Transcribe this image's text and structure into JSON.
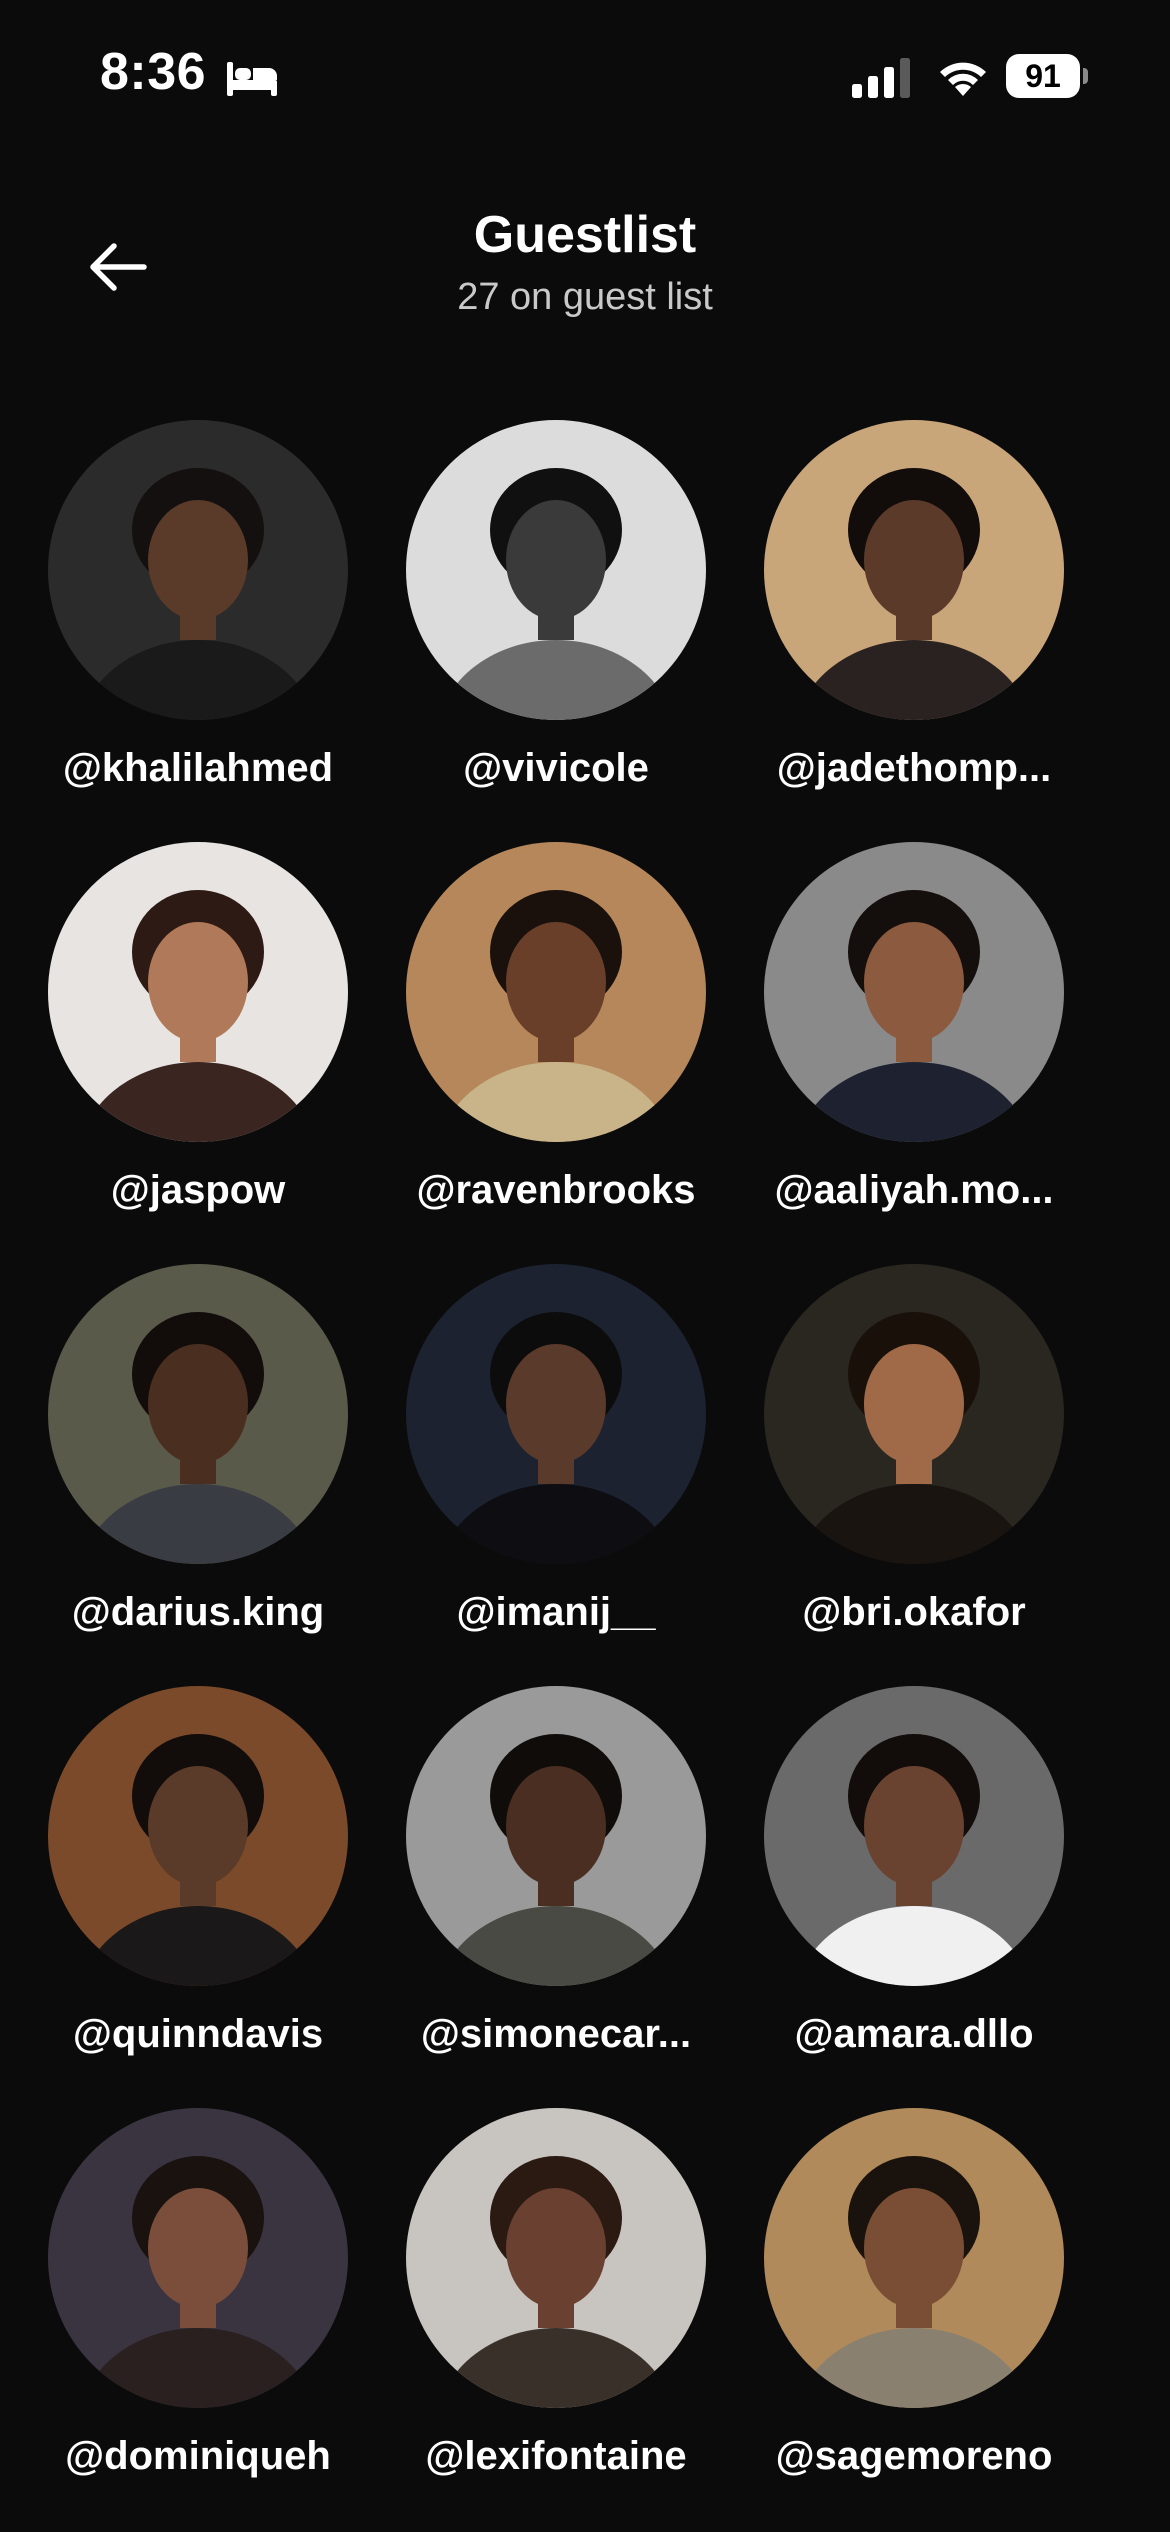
{
  "status_bar": {
    "time": "8:36",
    "battery": "91",
    "icons": [
      "bed-icon",
      "cellular-signal-icon",
      "wifi-icon",
      "battery-icon"
    ]
  },
  "header": {
    "back_icon": "arrow-left-icon",
    "title": "Guestlist",
    "subtitle": "27 on guest list"
  },
  "guests": [
    {
      "handle": "@khalilahmed",
      "bg": "#2b2b2b",
      "skin": "#5a3a28",
      "hair": "#141010",
      "shirt": "#1a1a1a"
    },
    {
      "handle": "@vivicole",
      "bg": "#dcdcdc",
      "skin": "#3a3a3a",
      "hair": "#101010",
      "shirt": "#6b6b6b"
    },
    {
      "handle": "@jadethomp...",
      "bg": "#c9a57a",
      "skin": "#5b3a2a",
      "hair": "#120c0a",
      "shirt": "#2a2220"
    },
    {
      "handle": "@jaspow",
      "bg": "#e8e4e2",
      "skin": "#b07a5a",
      "hair": "#2e1a14",
      "shirt": "#3a2520"
    },
    {
      "handle": "@ravenbrooks",
      "bg": "#b5875a",
      "skin": "#6a3f2a",
      "hair": "#1a100c",
      "shirt": "#c9b48a"
    },
    {
      "handle": "@aaliyah.mo...",
      "bg": "#8a8a8a",
      "skin": "#8c5a3e",
      "hair": "#140e0c",
      "shirt": "#1e2230"
    },
    {
      "handle": "@darius.king",
      "bg": "#5a5a4a",
      "skin": "#4a2e20",
      "hair": "#120c0a",
      "shirt": "#3a3c44"
    },
    {
      "handle": "@imanij__",
      "bg": "#1c2230",
      "skin": "#5a3a2a",
      "hair": "#0c0c0c",
      "shirt": "#0e0e12"
    },
    {
      "handle": "@bri.okafor",
      "bg": "#2a2620",
      "skin": "#a06a48",
      "hair": "#1a100a",
      "shirt": "#1a1410"
    },
    {
      "handle": "@quinndavis",
      "bg": "#7a4a2a",
      "skin": "#5a3a28",
      "hair": "#120c0a",
      "shirt": "#1a1818"
    },
    {
      "handle": "@simonecar...",
      "bg": "#9a9a9a",
      "skin": "#4a2e22",
      "hair": "#100c0a",
      "shirt": "#4a4a44"
    },
    {
      "handle": "@amara.dllo",
      "bg": "#6a6a6a",
      "skin": "#6a4230",
      "hair": "#120c0a",
      "shirt": "#f0f0f0"
    },
    {
      "handle": "@dominiqueh",
      "bg": "#3a3440",
      "skin": "#7a4e3a",
      "hair": "#1a120e",
      "shirt": "#2a2020"
    },
    {
      "handle": "@lexifontaine",
      "bg": "#c8c4c0",
      "skin": "#6a4030",
      "hair": "#2a1a12",
      "shirt": "#3a302a"
    },
    {
      "handle": "@sagemoreno",
      "bg": "#b08a5a",
      "skin": "#7a4e34",
      "hair": "#1a120c",
      "shirt": "#8a8070"
    }
  ]
}
